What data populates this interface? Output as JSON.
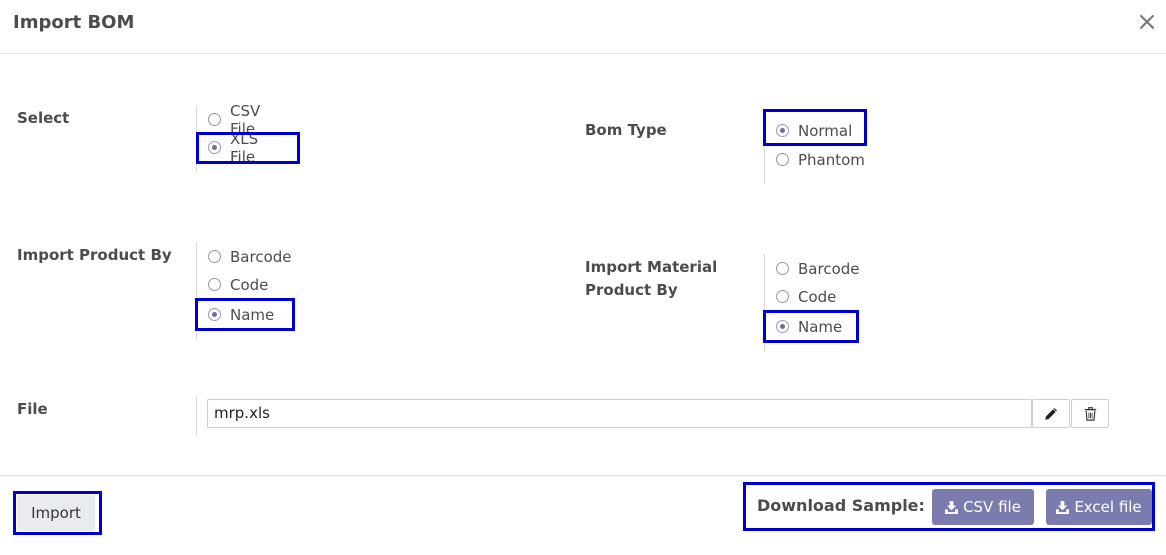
{
  "dialog": {
    "title": "Import BOM",
    "close_symbol": "×"
  },
  "select": {
    "label": "Select",
    "options": [
      {
        "label": "CSV File",
        "checked": false
      },
      {
        "label": "XLS File",
        "checked": true
      }
    ]
  },
  "bom_type": {
    "label": "Bom Type",
    "options": [
      {
        "label": "Normal",
        "checked": true
      },
      {
        "label": "Phantom",
        "checked": false
      }
    ]
  },
  "import_product_by": {
    "label": "Import Product By",
    "options": [
      {
        "label": "Barcode",
        "checked": false
      },
      {
        "label": "Code",
        "checked": false
      },
      {
        "label": "Name",
        "checked": true
      }
    ]
  },
  "import_material_product_by": {
    "label_line1": "Import Material",
    "label_line2": "Product By",
    "options": [
      {
        "label": "Barcode",
        "checked": false
      },
      {
        "label": "Code",
        "checked": false
      },
      {
        "label": "Name",
        "checked": true
      }
    ]
  },
  "file": {
    "label": "File",
    "value": "mrp.xls",
    "edit_icon": "pencil-icon",
    "delete_icon": "trash-icon"
  },
  "footer": {
    "import_label": "Import",
    "download_label": "Download Sample:",
    "csv_button": "CSV file",
    "excel_button": "Excel file",
    "download_icon": "download-icon"
  },
  "colors": {
    "accent": "#7c7bad",
    "highlight": "#0000cc",
    "radio_dot": "#6e6ea3"
  }
}
